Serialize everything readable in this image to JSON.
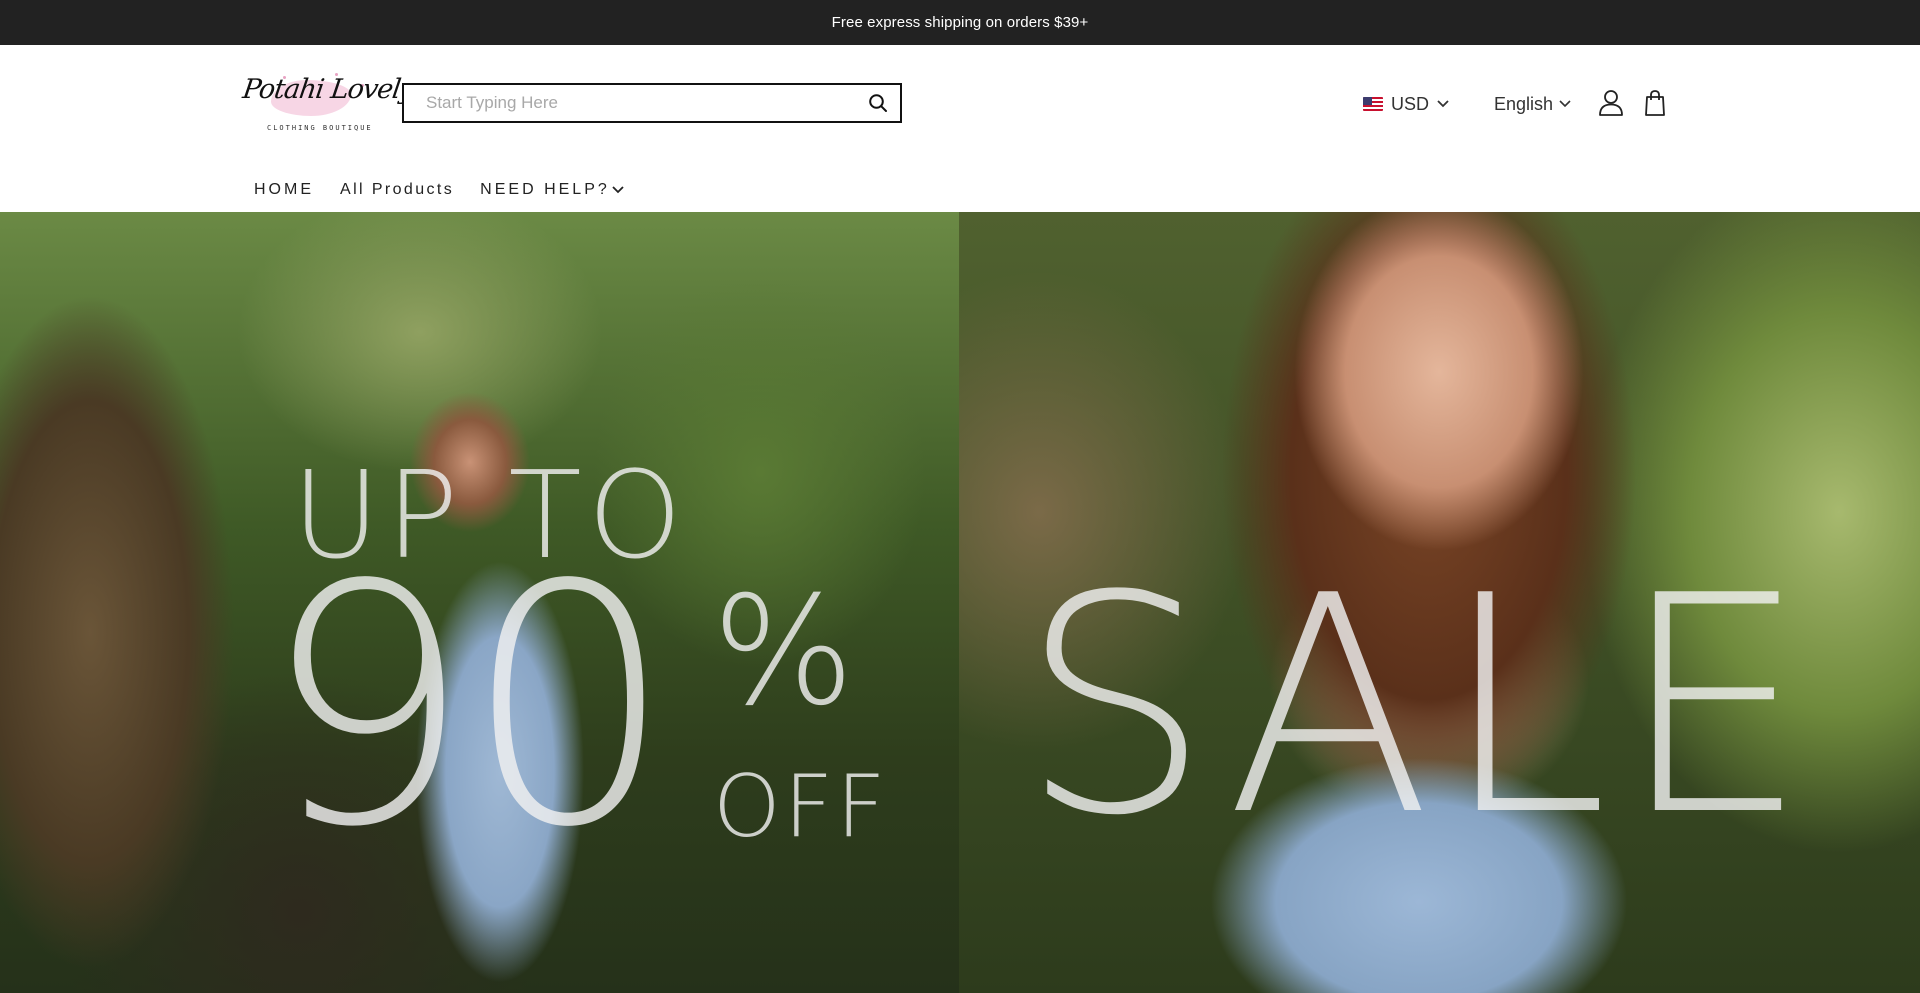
{
  "announcement": {
    "text": "Free express shipping on orders $39+"
  },
  "header": {
    "logo": {
      "script_text": "Potahi Lovely",
      "tagline": "CLOTHING BOUTIQUE"
    },
    "search": {
      "placeholder": "Start Typing Here",
      "value": ""
    },
    "currency": {
      "label": "USD",
      "flag_icon": "us-flag-icon"
    },
    "language": {
      "label": "English"
    },
    "icons": [
      "search-icon",
      "chevron-down-icon",
      "account-icon",
      "cart-icon"
    ]
  },
  "nav": {
    "items": [
      {
        "label": "HOME"
      },
      {
        "label": "All Products"
      },
      {
        "label": "NEED HELP?",
        "has_dropdown": true
      }
    ]
  },
  "hero": {
    "line_upto": "UP TO",
    "big_number": "90",
    "percent": "%",
    "off": "OFF",
    "sale": "SALE"
  },
  "colors": {
    "announcement_bg": "#222222",
    "announcement_text": "#ffffff",
    "logo_accent": "#f6cfe0",
    "search_border": "#111111"
  }
}
